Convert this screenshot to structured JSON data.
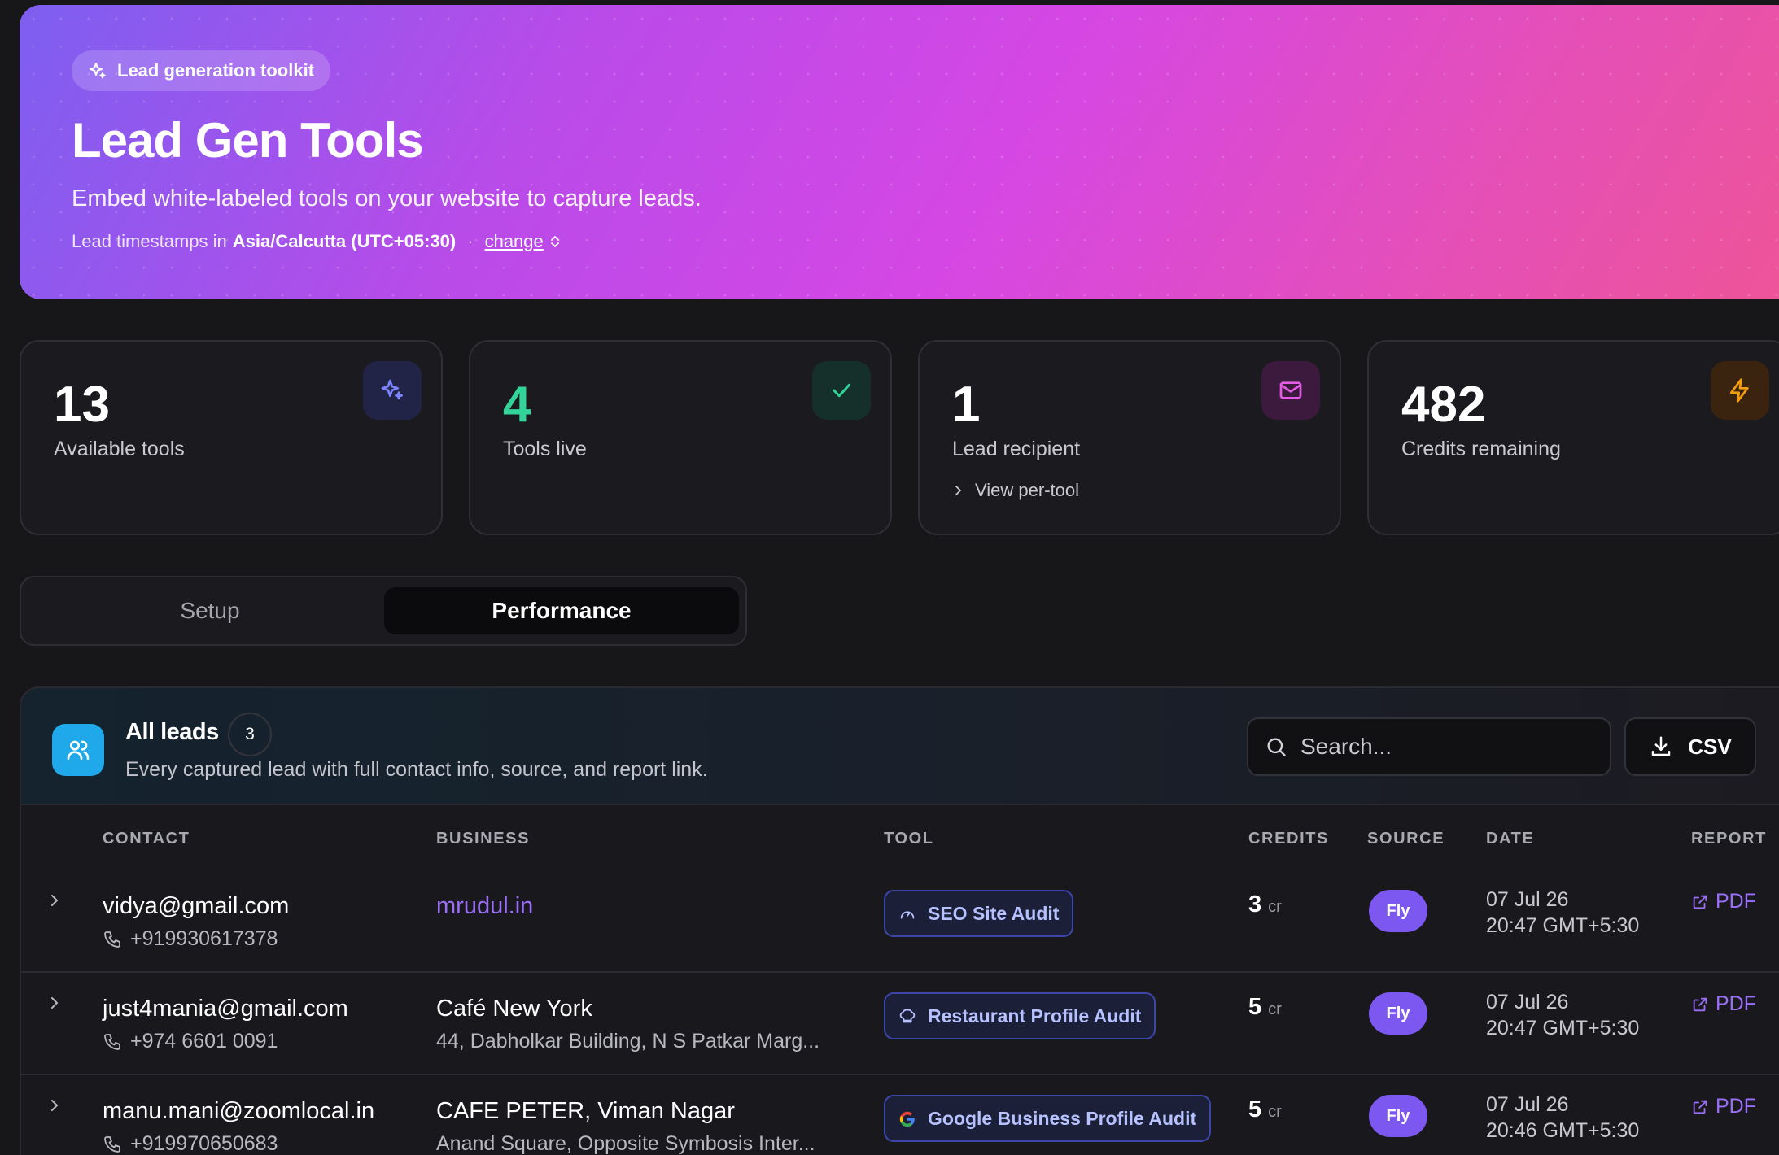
{
  "hero": {
    "chip_label": "Lead generation toolkit",
    "title": "Lead Gen Tools",
    "subtitle": "Embed white-labeled tools on your website to capture leads.",
    "tz_prefix": "Lead timestamps in",
    "tz_value": "Asia/Calcutta (UTC+05:30)",
    "tz_separator": "·",
    "change_label": "change"
  },
  "stats": [
    {
      "value": "13",
      "label": "Available tools",
      "icon": "sparkles-icon",
      "accent": "#7b83ff",
      "value_color": "#ffffff"
    },
    {
      "value": "4",
      "label": "Tools live",
      "icon": "check-icon",
      "accent": "#34d399",
      "value_color": "#34d399"
    },
    {
      "value": "1",
      "label": "Lead recipient",
      "link": "View per-tool",
      "icon": "mail-icon",
      "accent": "#e45ce6",
      "value_color": "#ffffff"
    },
    {
      "value": "482",
      "label": "Credits remaining",
      "icon": "bolt-icon",
      "accent": "#f59e0b",
      "value_color": "#ffffff"
    }
  ],
  "tabs": {
    "setup": "Setup",
    "performance": "Performance",
    "active": "performance"
  },
  "leads": {
    "title": "All leads",
    "count": "3",
    "description": "Every captured lead with full contact info, source, and report link.",
    "search_placeholder": "Search...",
    "csv_label": "CSV",
    "columns": [
      "CONTACT",
      "BUSINESS",
      "TOOL",
      "CREDITS",
      "SOURCE",
      "DATE",
      "REPORT"
    ],
    "rows": [
      {
        "email": "vidya@gmail.com",
        "phone": "+919930617378",
        "business": "mrudul.in",
        "business_is_link": true,
        "address": "",
        "tool": "SEO Site Audit",
        "tool_icon": "gauge-icon",
        "credits": "3",
        "credits_unit": "cr",
        "source": "Fly",
        "date_line1": "07 Jul 26",
        "date_line2": "20:47 GMT+5:30",
        "report": "PDF"
      },
      {
        "email": "just4mania@gmail.com",
        "phone": "+974 6601 0091",
        "business": "Café New York",
        "business_is_link": false,
        "address": "44, Dabholkar Building, N S Patkar Marg...",
        "tool": "Restaurant Profile Audit",
        "tool_icon": "chef-hat-icon",
        "credits": "5",
        "credits_unit": "cr",
        "source": "Fly",
        "date_line1": "07 Jul 26",
        "date_line2": "20:47 GMT+5:30",
        "report": "PDF"
      },
      {
        "email": "manu.mani@zoomlocal.in",
        "phone": "+919970650683",
        "business": "CAFE PETER, Viman Nagar",
        "business_is_link": false,
        "address": "Anand Square, Opposite Symbosis Inter...",
        "tool": "Google Business Profile Audit",
        "tool_icon": "google-icon",
        "credits": "5",
        "credits_unit": "cr",
        "source": "Fly",
        "date_line1": "07 Jul 26",
        "date_line2": "20:46 GMT+5:30",
        "report": "PDF"
      }
    ]
  }
}
